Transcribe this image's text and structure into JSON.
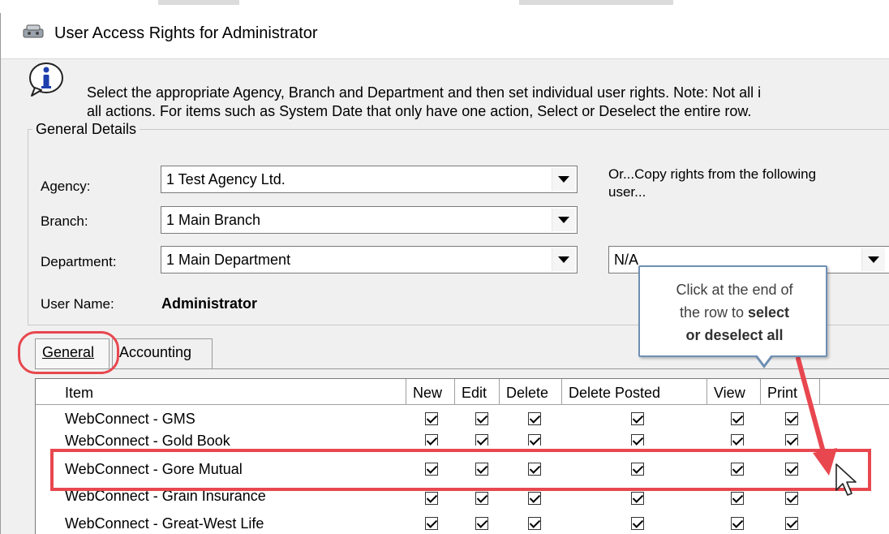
{
  "window": {
    "title": "User Access Rights for Administrator",
    "title_icon": "key-users-icon"
  },
  "note": {
    "icon": "info-icon",
    "line1": "Select the appropriate Agency, Branch and Department and then set individual user rights.  Note:  Not all i",
    "line2": "all actions.  For items such as System Date that only have one action, Select or Deselect the entire row."
  },
  "general_details": {
    "legend": "General Details",
    "agency": {
      "label": "Agency:",
      "value": "1 Test Agency Ltd."
    },
    "branch": {
      "label": "Branch:",
      "value": "1 Main Branch"
    },
    "department": {
      "label": "Department:",
      "value": "1 Main Department"
    },
    "user_name": {
      "label": "User Name:",
      "value": "Administrator"
    },
    "copy_rights": {
      "label_line1": "Or...Copy rights from the following",
      "label_line2": "user...",
      "value": "N/A"
    }
  },
  "tabs": [
    {
      "label": "General",
      "underline": "G",
      "active": true
    },
    {
      "label": "Accounting",
      "underline": "A",
      "active": false
    }
  ],
  "grid": {
    "columns": [
      "Item",
      "New",
      "Edit",
      "Delete",
      "Delete Posted",
      "View",
      "Print"
    ],
    "rows": [
      {
        "item": "WebConnect - GMS",
        "checks": [
          true,
          true,
          true,
          true,
          true,
          true
        ]
      },
      {
        "item": "WebConnect - Gold Book",
        "checks": [
          true,
          true,
          true,
          true,
          true,
          true
        ]
      },
      {
        "item": "WebConnect - Gore Mutual",
        "checks": [
          true,
          true,
          true,
          true,
          true,
          true
        ]
      },
      {
        "item": "WebConnect - Grain Insurance",
        "checks": [
          true,
          true,
          true,
          true,
          true,
          true
        ]
      },
      {
        "item": "WebConnect - Great-West Life",
        "checks": [
          true,
          true,
          true,
          true,
          true,
          true
        ]
      }
    ]
  },
  "callout": {
    "line1": "Click at the end of",
    "line2_plain": "the row to ",
    "line2_bold": "select",
    "line3_bold": "or deselect all"
  },
  "colors": {
    "highlight_red": "#e8474f",
    "callout_border": "#6f8fb3"
  }
}
